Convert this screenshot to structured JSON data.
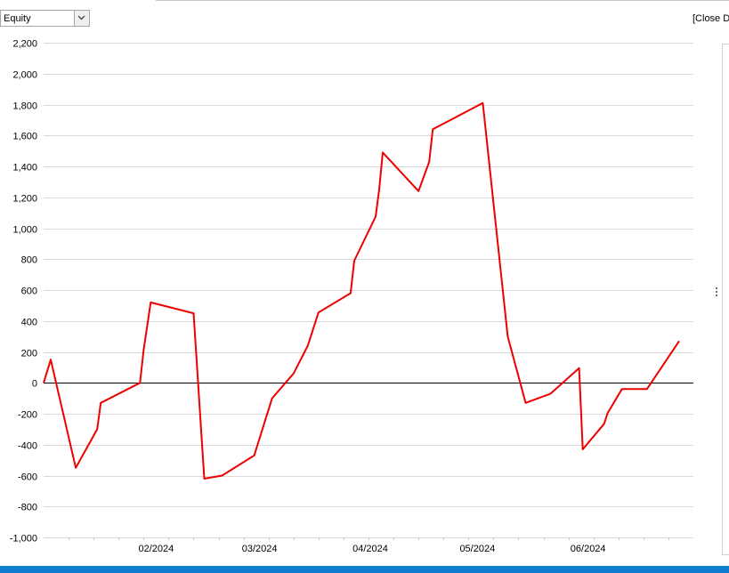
{
  "toolbar": {
    "metric_select": {
      "value": "Equity"
    },
    "close_label": "[Close Da"
  },
  "colors": {
    "series": "#ee0000",
    "zero_line": "#000000",
    "grid": "#d9d9d9",
    "status_bar": "#0f7ccf"
  },
  "chart_data": {
    "type": "line",
    "title": "",
    "xlabel": "",
    "ylabel": "",
    "x_range": [
      "2024-01-01",
      "2024-07-01"
    ],
    "ylim": [
      -1000,
      2200
    ],
    "y_ticks": [
      -1000,
      -800,
      -600,
      -400,
      -200,
      0,
      200,
      400,
      600,
      800,
      1000,
      1200,
      1400,
      1600,
      1800,
      2000,
      2200
    ],
    "y_tick_labels": [
      "-1,000",
      "-800",
      "-600",
      "-400",
      "-200",
      "0",
      "200",
      "400",
      "600",
      "800",
      "1,000",
      "1,200",
      "1,400",
      "1,600",
      "1,800",
      "2,000",
      "2,200"
    ],
    "x_ticks": [
      "2024-02-01",
      "2024-03-01",
      "2024-04-01",
      "2024-05-01",
      "2024-06-01"
    ],
    "x_tick_labels": [
      "02/2024",
      "03/2024",
      "04/2024",
      "05/2024",
      "06/2024"
    ],
    "x_minor_ticks": [
      "2024-01-08",
      "2024-01-15",
      "2024-01-22",
      "2024-01-29",
      "2024-02-05",
      "2024-02-12",
      "2024-02-19",
      "2024-02-26",
      "2024-03-04",
      "2024-03-11",
      "2024-03-18",
      "2024-03-25",
      "2024-04-01",
      "2024-04-08",
      "2024-04-15",
      "2024-04-22",
      "2024-04-29",
      "2024-05-06",
      "2024-05-13",
      "2024-05-20",
      "2024-05-27",
      "2024-06-03",
      "2024-06-10",
      "2024-06-17",
      "2024-06-24"
    ],
    "grid": true,
    "zero_line": true,
    "series": [
      {
        "points": [
          [
            "2024-01-01",
            0
          ],
          [
            "2024-01-03",
            150
          ],
          [
            "2024-01-10",
            -550
          ],
          [
            "2024-01-16",
            -300
          ],
          [
            "2024-01-17",
            -130
          ],
          [
            "2024-01-28",
            0
          ],
          [
            "2024-01-29",
            210
          ],
          [
            "2024-01-31",
            520
          ],
          [
            "2024-02-12",
            450
          ],
          [
            "2024-02-15",
            -620
          ],
          [
            "2024-02-20",
            -600
          ],
          [
            "2024-02-29",
            -470
          ],
          [
            "2024-03-05",
            -100
          ],
          [
            "2024-03-11",
            60
          ],
          [
            "2024-03-15",
            240
          ],
          [
            "2024-03-18",
            455
          ],
          [
            "2024-03-27",
            580
          ],
          [
            "2024-03-28",
            790
          ],
          [
            "2024-04-03",
            1075
          ],
          [
            "2024-04-04",
            1250
          ],
          [
            "2024-04-05",
            1490
          ],
          [
            "2024-04-15",
            1240
          ],
          [
            "2024-04-18",
            1430
          ],
          [
            "2024-04-19",
            1640
          ],
          [
            "2024-05-03",
            1810
          ],
          [
            "2024-05-10",
            300
          ],
          [
            "2024-05-15",
            -130
          ],
          [
            "2024-05-22",
            -70
          ],
          [
            "2024-05-30",
            95
          ],
          [
            "2024-05-31",
            -430
          ],
          [
            "2024-06-06",
            -265
          ],
          [
            "2024-06-07",
            -195
          ],
          [
            "2024-06-11",
            -40
          ],
          [
            "2024-06-18",
            -40
          ],
          [
            "2024-06-27",
            270
          ]
        ]
      }
    ]
  }
}
